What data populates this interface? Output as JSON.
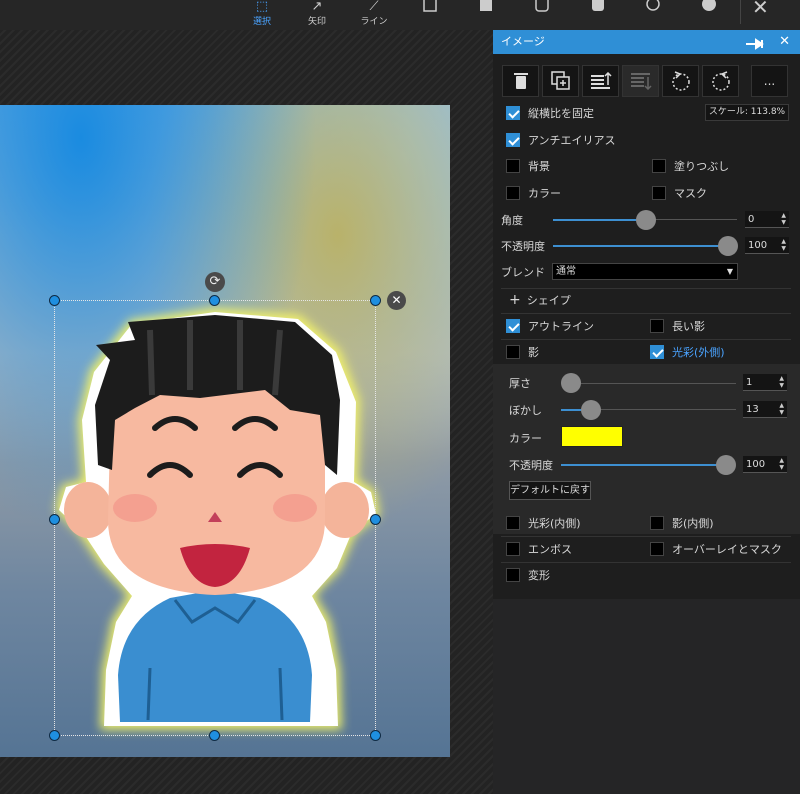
{
  "toolbar": {
    "tools": [
      {
        "label": "選択",
        "icon": "select-icon",
        "active": true
      },
      {
        "label": "矢印",
        "icon": "arrow-icon",
        "active": false
      },
      {
        "label": "ライン",
        "icon": "line-icon",
        "active": false
      }
    ],
    "shapes": [
      "rectangle-outline-icon",
      "rectangle-filled-icon",
      "rounded-rect-outline-icon",
      "rounded-rect-filled-icon",
      "circle-outline-icon",
      "circle-filled-icon"
    ],
    "close_icon": "close-icon"
  },
  "canvas": {
    "accent": "#1f8fe0",
    "glow_color": "#f0f000"
  },
  "panel": {
    "title": "イメージ",
    "actions": [
      "delete-icon",
      "duplicate-icon",
      "bring-front-icon",
      "send-back-icon",
      "rotate-left-icon",
      "rotate-right-icon",
      "more-icon"
    ],
    "more_label": "...",
    "scale_label": "スケール: 113.8%",
    "keep_aspect": {
      "label": "縦横比を固定",
      "checked": true
    },
    "antialias": {
      "label": "アンチエイリアス",
      "checked": true
    },
    "background": {
      "label": "背景",
      "checked": false
    },
    "fill": {
      "label": "塗りつぶし",
      "checked": false
    },
    "color": {
      "label": "カラー",
      "checked": false
    },
    "mask": {
      "label": "マスク",
      "checked": false
    },
    "angle": {
      "label": "角度",
      "value": "0",
      "level": 0.5
    },
    "opacity": {
      "label": "不透明度",
      "value": "100",
      "level": 1.0
    },
    "blend": {
      "label": "ブレンド",
      "value": "通常"
    },
    "shape_section": "シェイプ",
    "outline": {
      "label": "アウトライン",
      "checked": true
    },
    "long_shadow": {
      "label": "長い影",
      "checked": false
    },
    "shadow": {
      "label": "影",
      "checked": false
    },
    "outer_glow": {
      "label": "光彩(外側)",
      "checked": true
    },
    "glow": {
      "thickness": {
        "label": "厚さ",
        "value": "1",
        "level": 0.0
      },
      "blur": {
        "label": "ぼかし",
        "value": "13",
        "level": 0.18
      },
      "color_label": "カラー",
      "color": "#ffff00",
      "opacity": {
        "label": "不透明度",
        "value": "100",
        "level": 1.0
      },
      "reset": "デフォルトに戻す"
    },
    "inner_glow": {
      "label": "光彩(内側)",
      "checked": false
    },
    "inner_shadow": {
      "label": "影(内側)",
      "checked": false
    },
    "emboss": {
      "label": "エンボス",
      "checked": false
    },
    "overlay_mask": {
      "label": "オーバーレイとマスク",
      "checked": false
    },
    "transform": {
      "label": "変形",
      "checked": false
    }
  }
}
